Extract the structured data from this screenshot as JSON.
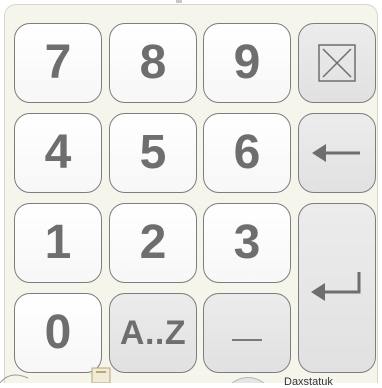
{
  "keypad": {
    "keys": {
      "seven": "7",
      "eight": "8",
      "nine": "9",
      "four": "4",
      "five": "5",
      "six": "6",
      "one": "1",
      "two": "2",
      "three": "3",
      "zero": "0",
      "alpha": "A..Z"
    },
    "icons": {
      "clear": "clear-box-icon",
      "backspace": "backspace-arrow-icon",
      "enter": "enter-return-icon",
      "dash": "dash-icon"
    },
    "colors": {
      "key_text": "#6e6e6e",
      "light_key": "#ffffff",
      "gray_key": "#e4e4e4",
      "panel": "#f6f5ec",
      "border": "#7d7d7d"
    }
  },
  "taskbar": {
    "partial_text": "Daxstatuk"
  }
}
